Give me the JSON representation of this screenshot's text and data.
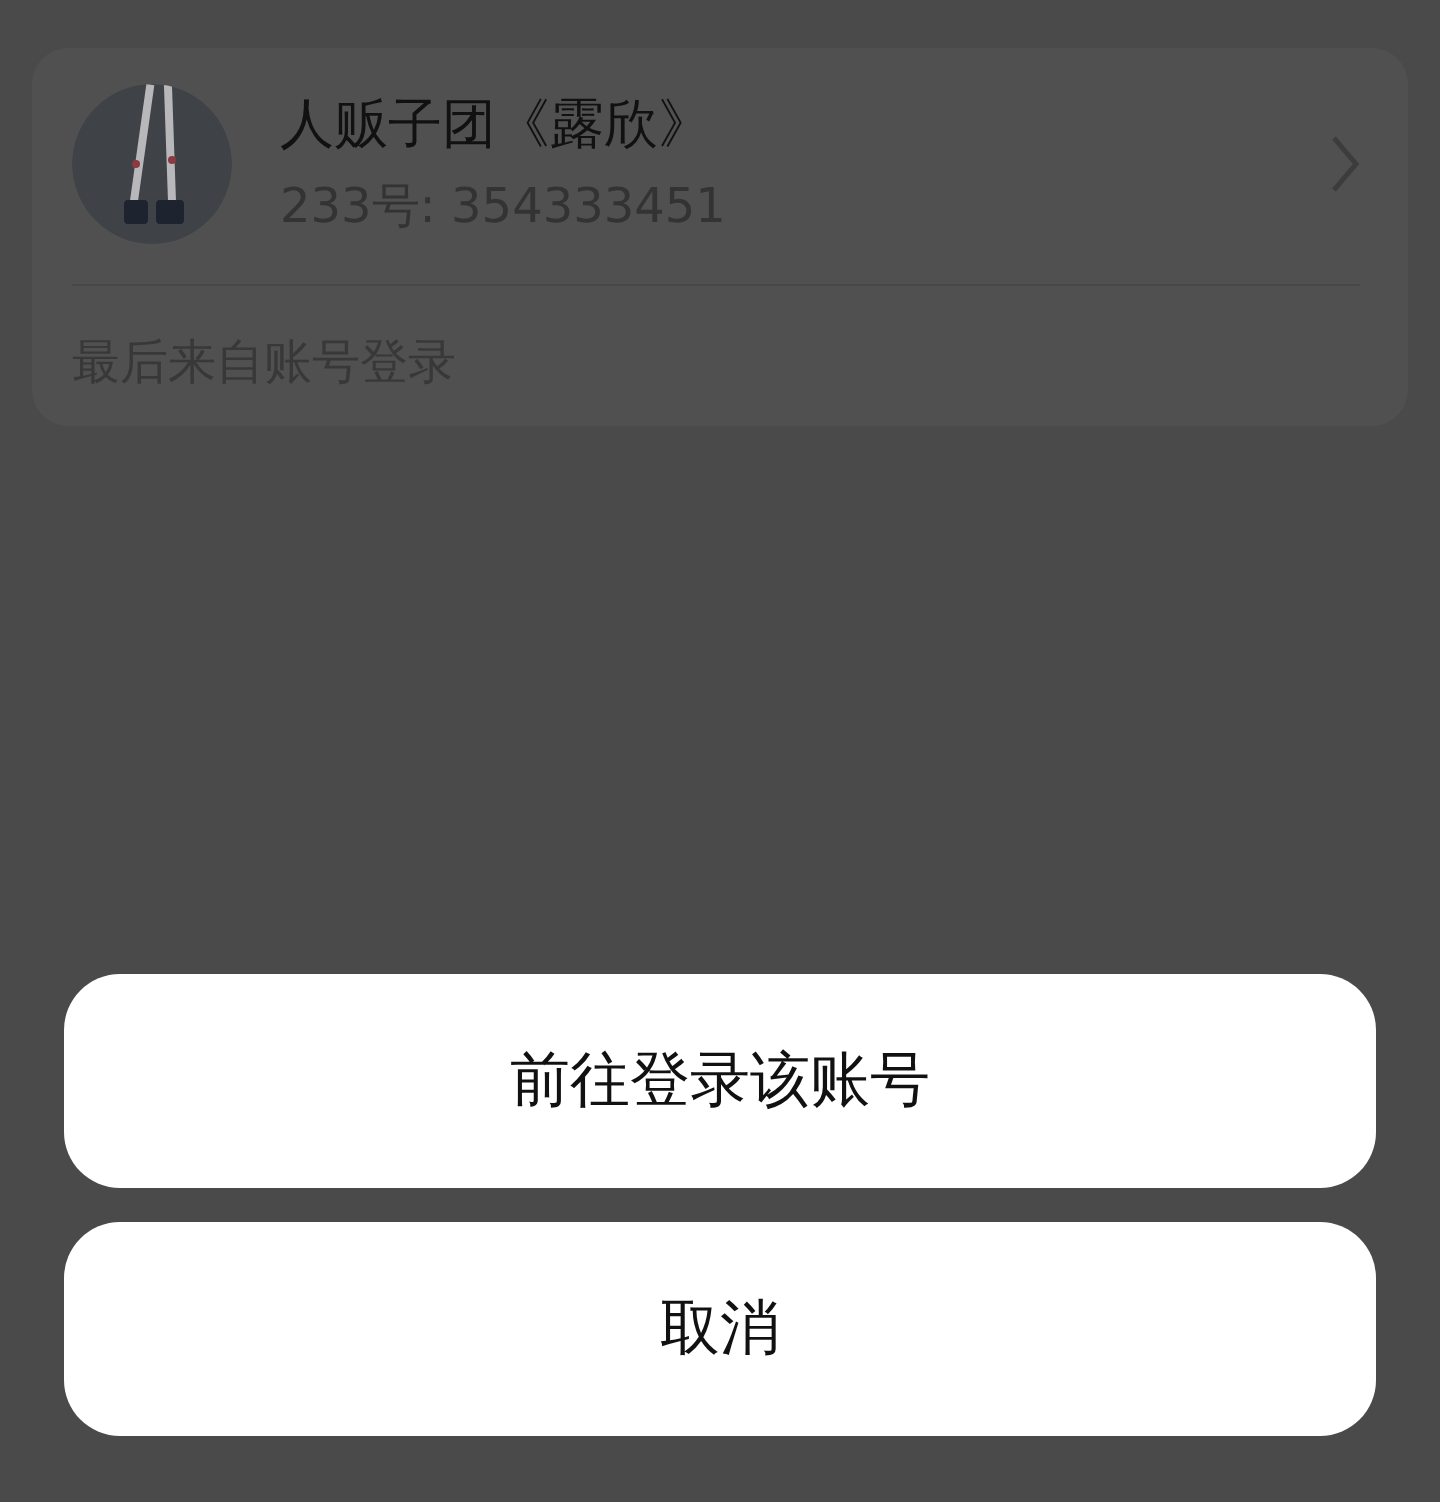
{
  "account_card": {
    "name": "人贩子团《露欣》",
    "account_id": "233号: 354333451",
    "footer": "最后来自账号登录"
  },
  "action_sheet": {
    "buttons": [
      {
        "label": "前往登录该账号"
      },
      {
        "label": "取消"
      }
    ]
  }
}
